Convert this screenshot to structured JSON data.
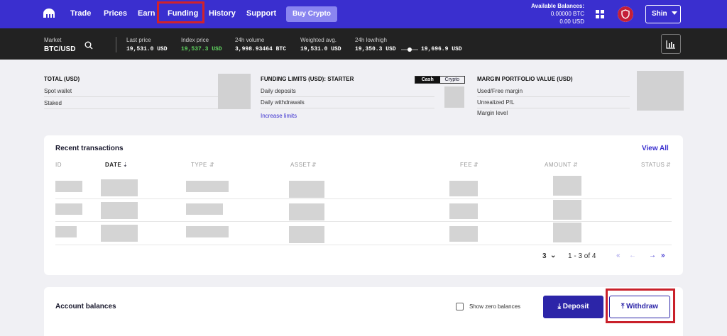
{
  "nav": {
    "items": [
      "Trade",
      "Prices",
      "Earn",
      "Funding",
      "History",
      "Support"
    ],
    "buy_label": "Buy Crypto",
    "balances_title": "Available Balances:",
    "balance_btc": "0.00000 BTC",
    "balance_usd": "0.00 USD",
    "user_label": "Shin"
  },
  "market": {
    "market_label": "Market",
    "pair": "BTC/USD",
    "stats": [
      {
        "label": "Last price",
        "value": "19,531.0 USD"
      },
      {
        "label": "Index price",
        "value": "19,537.3 USD"
      },
      {
        "label": "24h volume",
        "value": "3,998.93464 BTC"
      },
      {
        "label": "Weighted avg.",
        "value": "19,531.0 USD"
      },
      {
        "label": "24h low/high",
        "value": "19,350.3 USD"
      }
    ],
    "high_value": "19,696.9 USD"
  },
  "summary": {
    "total_title": "TOTAL (USD)",
    "spot": "Spot wallet",
    "staked": "Staked",
    "funding_title": "FUNDING LIMITS (USD): STARTER",
    "cash": "Cash",
    "crypto": "Crypto",
    "daily_deposits": "Daily deposits",
    "daily_withdrawals": "Daily withdrawals",
    "increase": "Increase limits",
    "margin_title": "MARGIN PORTFOLIO VALUE (USD)",
    "used_free": "Used/Free margin",
    "unrealized": "Unrealized P/L",
    "margin_level": "Margin level"
  },
  "transactions": {
    "title": "Recent transactions",
    "view_all": "View All",
    "columns": [
      "ID",
      "DATE",
      "TYPE",
      "ASSET",
      "FEE",
      "AMOUNT",
      "STATUS"
    ],
    "per_page": "3",
    "range": "1 - 3 of 4"
  },
  "balances": {
    "title": "Account balances",
    "show_zero": "Show zero balances",
    "deposit": "Deposit",
    "withdraw": "Withdraw"
  },
  "colors": {
    "brand": "#3a2fcf",
    "highlight": "#d1222b",
    "positive": "#5fd35f"
  }
}
